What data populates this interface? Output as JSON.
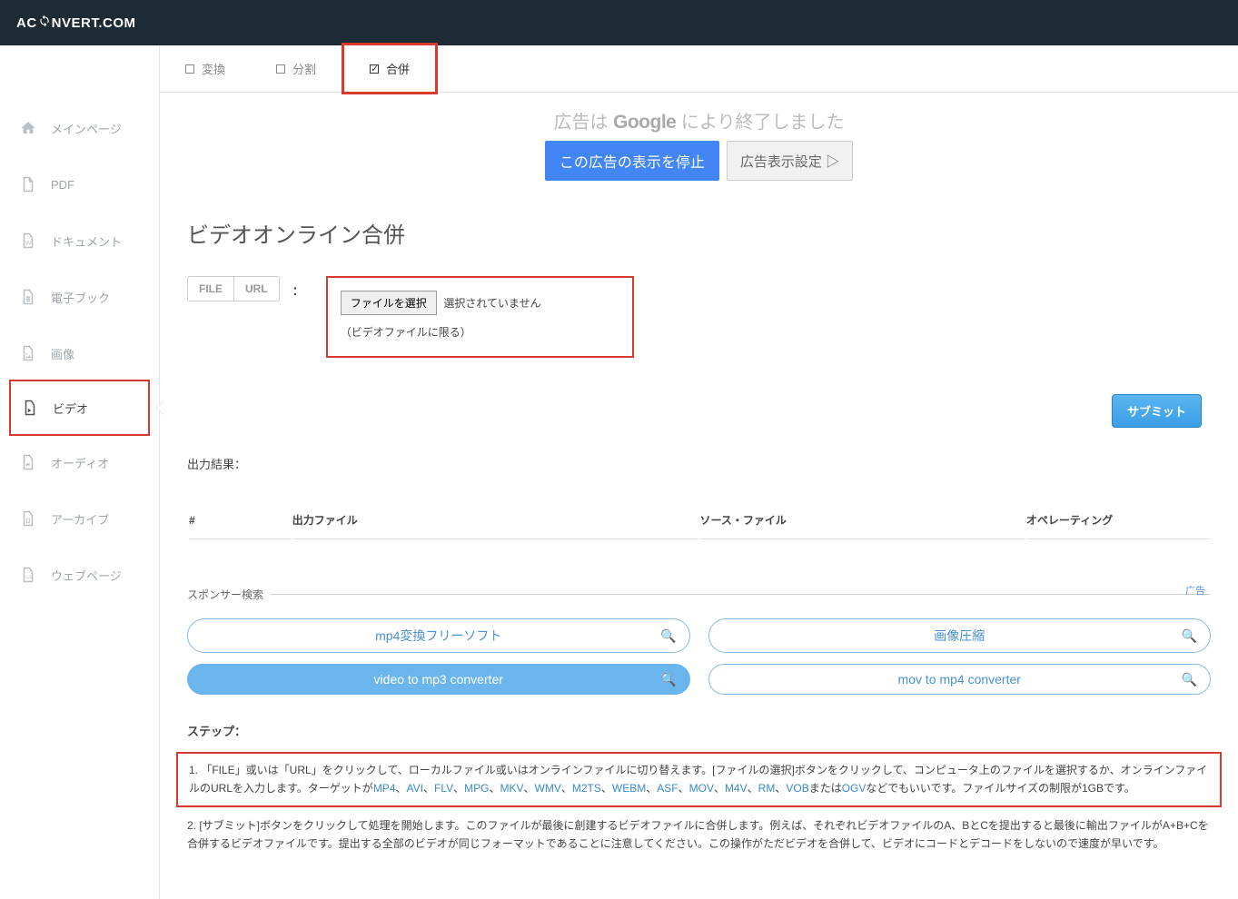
{
  "logo": {
    "pre": "AC",
    "post": "NVERT.COM"
  },
  "sidebar": [
    {
      "label": "メインページ"
    },
    {
      "label": "PDF"
    },
    {
      "label": "ドキュメント"
    },
    {
      "label": "電子ブック"
    },
    {
      "label": "画像"
    },
    {
      "label": "ビデオ"
    },
    {
      "label": "オーディオ"
    },
    {
      "label": "アーカイブ"
    },
    {
      "label": "ウェブページ"
    }
  ],
  "tabs": {
    "t0": "変換",
    "t1": "分割",
    "t2": "合併"
  },
  "ad": {
    "line": "広告は Google により終了しました",
    "google": "Google",
    "pre": "広告は ",
    "post": " により終了しました",
    "stop": "この広告の表示を停止",
    "settings": "広告表示設定 ▷"
  },
  "title": "ビデオオンライン合併",
  "seg": {
    "file": "FILE",
    "url": "URL"
  },
  "file": {
    "btn": "ファイルを選択",
    "status": "選択されていません",
    "note": "（ビデオファイルに限る）"
  },
  "submit": "サブミット",
  "outputLabel": "出力結果：",
  "table": {
    "h0": "#",
    "h1": "出力ファイル",
    "h2": "ソース・ファイル",
    "h3": "オペレーティング"
  },
  "sponsor": {
    "legend": "スポンサー検索",
    "adLabel": "广告",
    "items": [
      "mp4変換フリーソフト",
      "画像圧縮",
      "video to mp3 converter",
      "mov to mp4 converter"
    ]
  },
  "stepsLabel": "ステップ：",
  "step1": {
    "pre": "1. 「FILE」或いは「URL」をクリックして、ローカルファイル或いはオンラインファイルに切り替えます。[ファイルの選択]ボタンをクリックして、コンピュータ上のファイルを選択するか、オンラインファイルのURLを入力します。ターゲットが",
    "formats": [
      "MP4",
      "AVI",
      "FLV",
      "MPG",
      "MKV",
      "WMV",
      "M2TS",
      "WEBM",
      "ASF",
      "MOV",
      "M4V",
      "RM",
      "VOB"
    ],
    "mid": "または",
    "lastFmt": "OGV",
    "post": "などでもいいです。ファイルサイズの制限が1GBです。"
  },
  "step2": "2. [サブミット]ボタンをクリックして処理を開始します。このファイルが最後に創建するビデオファイルに合併します。例えば、それぞれビデオファイルのA、BとCを提出すると最後に輸出ファイルがA+B+Cを合併するビデオファイルです。提出する全部のビデオが同じフォーマットであることに注意してください。この操作がただビデオを合併して、ビデオにコードとデコードをしないので速度が早いです。"
}
